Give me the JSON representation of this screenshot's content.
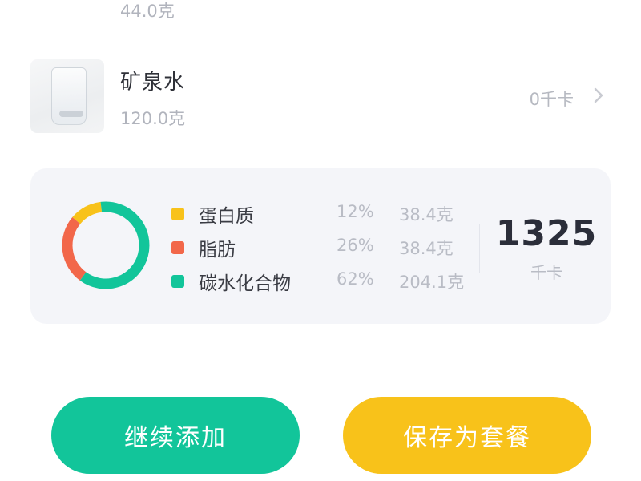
{
  "food_list": {
    "items": [
      {
        "name": "",
        "weight": "44.0克",
        "thumbnail_icon": "dark-food-image"
      },
      {
        "name": "矿泉水",
        "weight": "120.0克",
        "kcal": "0千卡",
        "thumbnail_icon": "water-glass-image"
      }
    ]
  },
  "summary": {
    "total_kcal": "1325",
    "total_unit": "千卡",
    "chart_data": {
      "type": "pie",
      "categories": [
        "蛋白质",
        "脂肪",
        "碳水化合物"
      ],
      "values": [
        12,
        26,
        62
      ],
      "colors": [
        "#f8c21a",
        "#f2674a",
        "#12c59a"
      ]
    },
    "nutrients": [
      {
        "name": "蛋白质",
        "percent": "12%",
        "amount": "38.4克",
        "color": "#f8c21a"
      },
      {
        "name": "脂肪",
        "percent": "26%",
        "amount": "38.4克",
        "color": "#f2674a"
      },
      {
        "name": "碳水化合物",
        "percent": "62%",
        "amount": "204.1克",
        "color": "#12c59a"
      }
    ]
  },
  "actions": {
    "continue_label": "继续添加",
    "save_label": "保存为套餐",
    "continue_color": "#12c59a",
    "save_color": "#f8c21a"
  }
}
